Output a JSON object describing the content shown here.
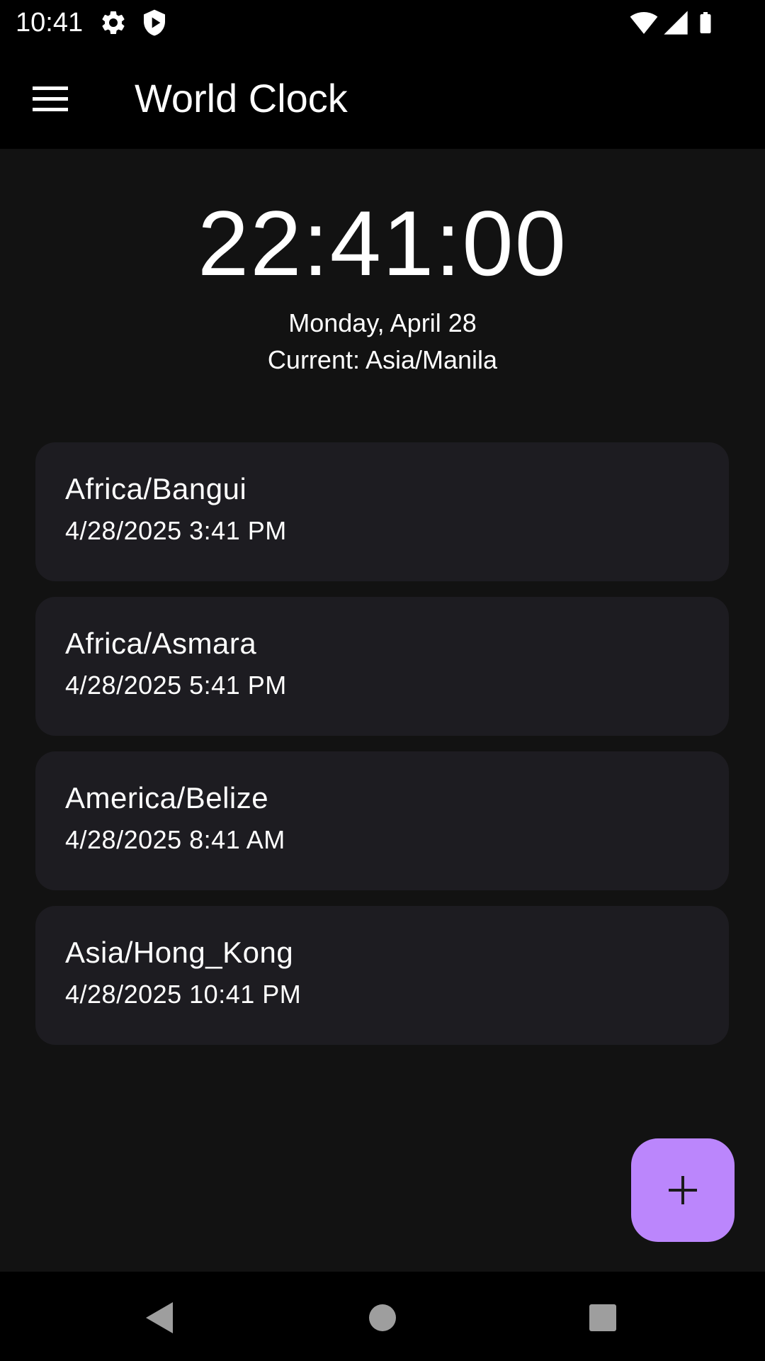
{
  "status_bar": {
    "time": "10:41",
    "icons": [
      "gear-icon",
      "shield-icon",
      "wifi-icon",
      "signal-icon",
      "battery-icon"
    ]
  },
  "app_bar": {
    "title": "World Clock",
    "menu_icon": "hamburger-menu-icon"
  },
  "clock": {
    "time": "22:41:00",
    "date": "Monday, April 28",
    "current_zone": "Current: Asia/Manila"
  },
  "zones": [
    {
      "name": "Africa/Bangui",
      "time": "4/28/2025 3:41 PM"
    },
    {
      "name": "Africa/Asmara",
      "time": "4/28/2025 5:41 PM"
    },
    {
      "name": "America/Belize",
      "time": "4/28/2025 8:41 AM"
    },
    {
      "name": "Asia/Hong_Kong",
      "time": "4/28/2025 10:41 PM"
    }
  ],
  "fab": {
    "icon": "plus-icon"
  },
  "nav_bar": {
    "icons": [
      "back-icon",
      "home-icon",
      "recents-icon"
    ]
  },
  "colors": {
    "background": "#121212",
    "app_bar": "#000000",
    "card": "#1d1c21",
    "fab": "#bb86fc",
    "text": "#ffffff"
  }
}
